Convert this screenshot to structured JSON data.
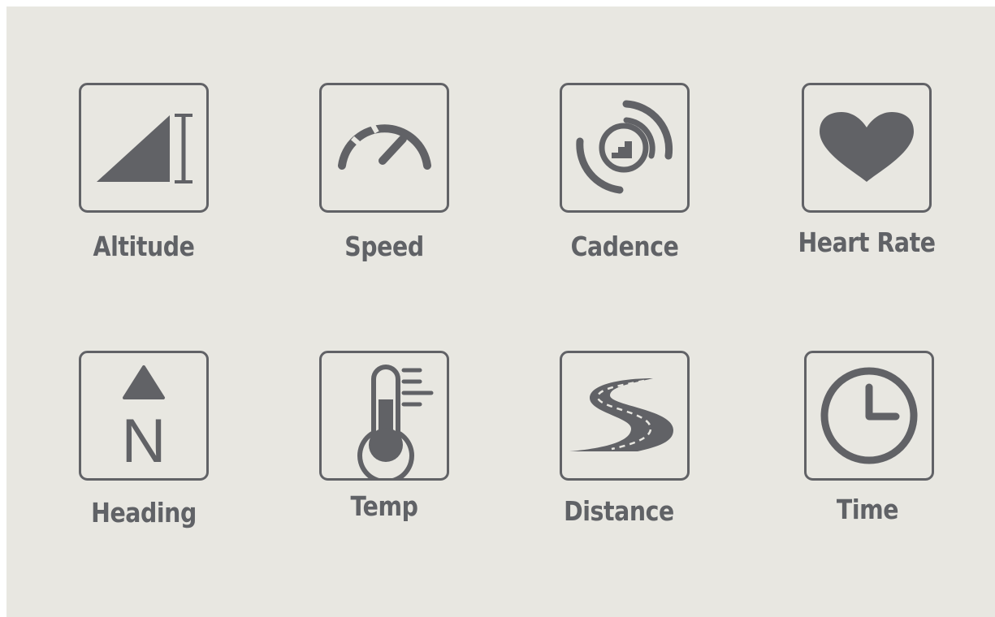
{
  "colors": {
    "background": "#e8e7e1",
    "icon": "#616266",
    "text": "#606266"
  },
  "tiles": [
    {
      "label": "Altitude",
      "icon": "altitude-icon"
    },
    {
      "label": "Speed",
      "icon": "speedometer-icon"
    },
    {
      "label": "Cadence",
      "icon": "cadence-icon"
    },
    {
      "label": "Heart Rate",
      "icon": "heart-icon"
    },
    {
      "label": "Heading",
      "icon": "compass-north-icon"
    },
    {
      "label": "Temp",
      "icon": "thermometer-icon"
    },
    {
      "label": "Distance",
      "icon": "road-icon"
    },
    {
      "label": "Time",
      "icon": "clock-icon"
    }
  ],
  "heading_letter": "N"
}
